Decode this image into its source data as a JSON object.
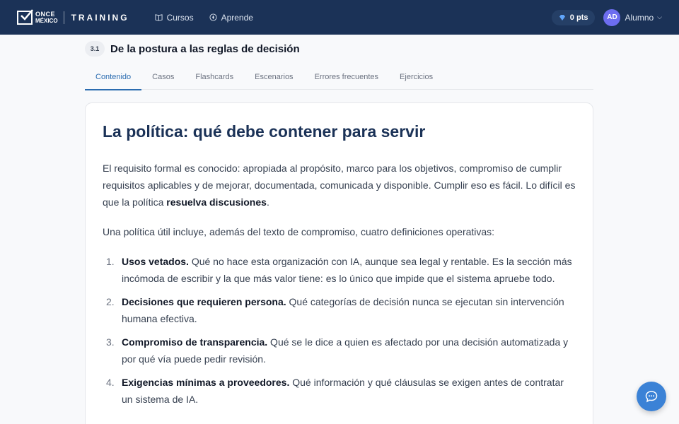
{
  "header": {
    "logo_line1": "ONCE",
    "logo_line2": "MÉXICO",
    "brand": "TRAINING",
    "nav": [
      {
        "label": "Cursos",
        "icon": "book-icon"
      },
      {
        "label": "Aprende",
        "icon": "compass-icon"
      }
    ],
    "points": "0 pts",
    "avatar_initials": "AD",
    "user_name": "Alumno"
  },
  "section": {
    "number": "3.1",
    "title": "De la postura a las reglas de decisión"
  },
  "tabs": [
    {
      "label": "Contenido",
      "active": true
    },
    {
      "label": "Casos",
      "active": false
    },
    {
      "label": "Flashcards",
      "active": false
    },
    {
      "label": "Escenarios",
      "active": false
    },
    {
      "label": "Errores frecuentes",
      "active": false
    },
    {
      "label": "Ejercicios",
      "active": false
    }
  ],
  "content": {
    "title": "La política: qué debe contener para servir",
    "para1_before": "El requisito formal es conocido: apropiada al propósito, marco para los objetivos, compromiso de cumplir requisitos aplicables y de mejorar, documentada, comunicada y disponible. Cumplir eso es fácil. Lo difícil es que la política ",
    "para1_bold": "resuelva discusiones",
    "para1_after": ".",
    "para2": "Una política útil incluye, además del texto de compromiso, cuatro definiciones operativas:",
    "items": [
      {
        "num": "1.",
        "bold": "Usos vetados.",
        "text": " Qué no hace esta organización con IA, aunque sea legal y rentable. Es la sección más incómoda de escribir y la que más valor tiene: es lo único que impide que el sistema apruebe todo."
      },
      {
        "num": "2.",
        "bold": "Decisiones que requieren persona.",
        "text": " Qué categorías de decisión nunca se ejecutan sin intervención humana efectiva."
      },
      {
        "num": "3.",
        "bold": "Compromiso de transparencia.",
        "text": " Qué se le dice a quien es afectado por una decisión automatizada y por qué vía puede pedir revisión."
      },
      {
        "num": "4.",
        "bold": "Exigencias mínimas a proveedores.",
        "text": " Qué información y qué cláusulas se exigen antes de contratar un sistema de IA."
      }
    ]
  },
  "colors": {
    "header_bg": "#1b3257",
    "accent": "#2b6cb0",
    "title": "#1b3257",
    "fab": "#3b82d6",
    "avatar": "#6d6df0"
  }
}
